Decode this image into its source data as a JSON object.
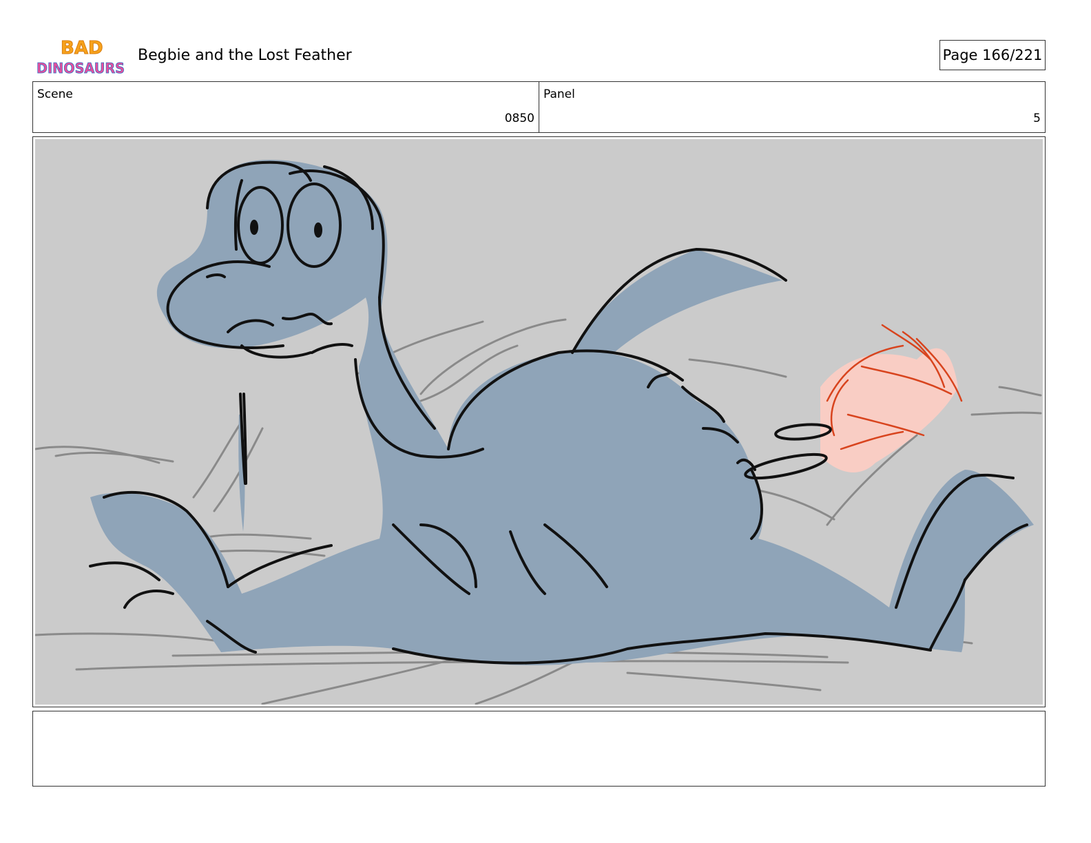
{
  "header": {
    "logo_line1": "BAD",
    "logo_line2": "DINOSAURS",
    "title": "Begbie and the Lost Feather",
    "page": "Page 166/221"
  },
  "info": {
    "scene_label": "Scene",
    "scene_value": "0850",
    "panel_label": "Panel",
    "panel_value": "5"
  },
  "colors": {
    "sky": "#cbcbcb",
    "dino": "#8fa4b8",
    "feather_fill": "#f9cdc4",
    "feather_line": "#d8441e",
    "ink": "#111111"
  },
  "notes": {
    "action_text": ""
  }
}
